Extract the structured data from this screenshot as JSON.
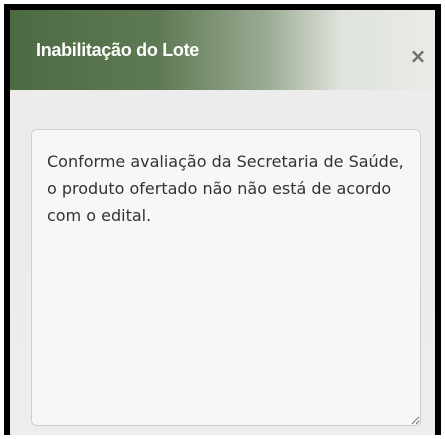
{
  "modal": {
    "title": "Inabilitação do Lote",
    "close_label": "×"
  },
  "textarea": {
    "value": "Conforme avaliação da Secretaria de Saúde, o produto ofertado não não está de acordo com o edital."
  }
}
